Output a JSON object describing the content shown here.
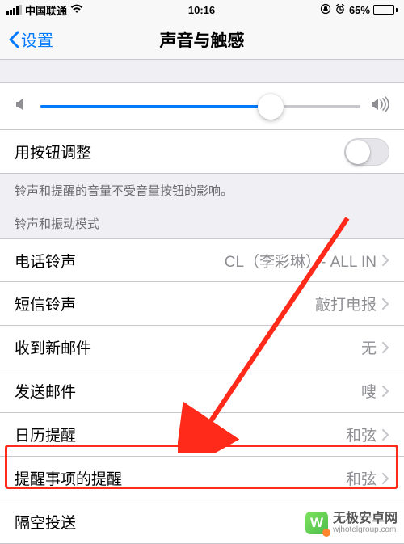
{
  "status_bar": {
    "carrier": "中国联通",
    "time": "10:16",
    "battery_pct": "65%"
  },
  "nav": {
    "back_label": "设置",
    "title": "声音与触感"
  },
  "volume": {
    "toggle_label": "用按钮调整",
    "footer_note": "铃声和提醒的音量不受音量按钮的影响。"
  },
  "sections": {
    "ringtone_header": "铃声和振动模式"
  },
  "rows": {
    "ringtone": {
      "label": "电话铃声",
      "value": "CL（李彩琳）- ALL IN"
    },
    "text_tone": {
      "label": "短信铃声",
      "value": "敲打电报"
    },
    "new_mail": {
      "label": "收到新邮件",
      "value": "无"
    },
    "sent_mail": {
      "label": "发送邮件",
      "value": "嗖"
    },
    "calendar": {
      "label": "日历提醒",
      "value": "和弦"
    },
    "reminder": {
      "label": "提醒事项的提醒",
      "value": "和弦"
    },
    "airdrop": {
      "label": "隔空投送",
      "value": ""
    }
  },
  "watermark": {
    "logo_letter": "W",
    "title": "无极安卓网",
    "url": "wjhotelgroup.com"
  },
  "colors": {
    "accent": "#007aff",
    "highlight": "#ff2a1a"
  }
}
